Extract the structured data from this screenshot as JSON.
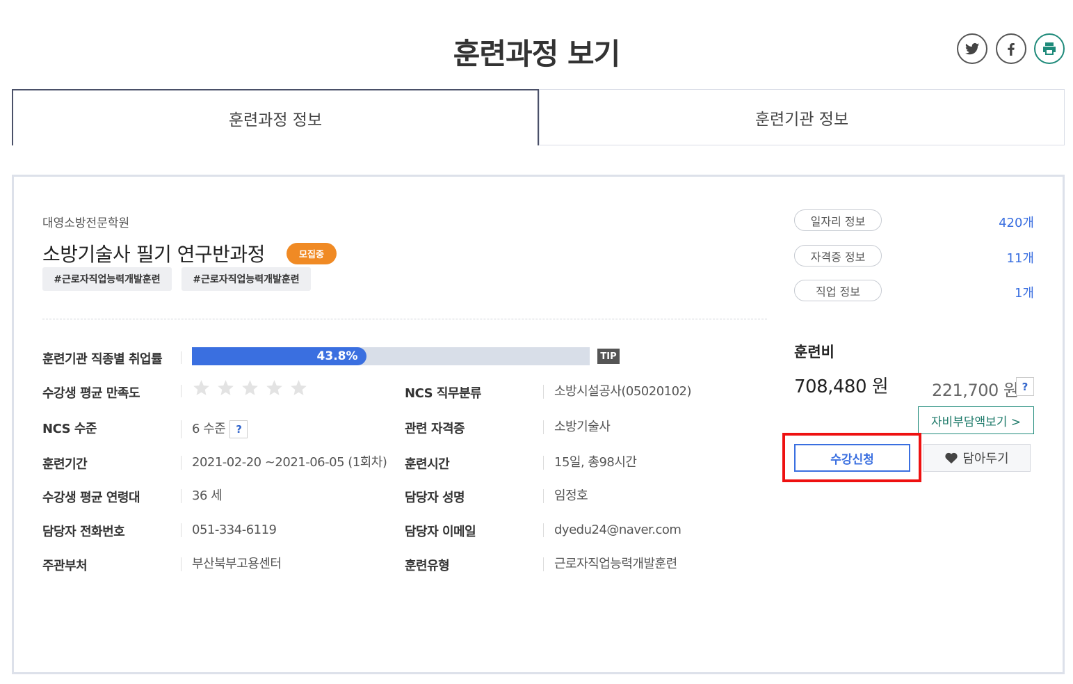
{
  "page_title": "훈련과정 보기",
  "share": {
    "twitter_icon": "twitter-icon",
    "facebook_icon": "facebook-icon",
    "print_icon": "print-icon"
  },
  "tabs": [
    {
      "label": "훈련과정 정보",
      "active": true
    },
    {
      "label": "훈련기관 정보",
      "active": false
    }
  ],
  "course": {
    "institution": "대영소방전문학원",
    "title": "소방기술사 필기 연구반과정",
    "badge": "모집중",
    "tags": [
      "#근로자직업능력개발훈련",
      "#근로자직업능력개발훈련"
    ]
  },
  "stats": {
    "employment_label": "훈련기관 직종별 취업률",
    "employment_rate": "43.8%",
    "employment_fraction": 0.438,
    "tip_label": "TIP",
    "satisfaction_label": "수강생 평균 만족도",
    "satisfaction_stars": 0,
    "satisfaction_max": 5
  },
  "info_left": [
    {
      "label": "NCS 수준",
      "value": "6 수준",
      "help": "?"
    },
    {
      "label": "훈련기간",
      "value": "2021-02-20 ~2021-06-05 (1회차)"
    },
    {
      "label": "수강생 평균 연령대",
      "value": "36 세"
    },
    {
      "label": "담당자 전화번호",
      "value": "051-334-6119"
    },
    {
      "label": "주관부처",
      "value": "부산북부고용센터"
    }
  ],
  "info_right": [
    {
      "label": "NCS 직무분류",
      "value": "소방시설공사(05020102)"
    },
    {
      "label": "관련 자격증",
      "value": "소방기술사"
    },
    {
      "label": "훈련시간",
      "value": "15일, 총98시간"
    },
    {
      "label": "담당자 성명",
      "value": "임정호"
    },
    {
      "label": "담당자 이메일",
      "value": "dyedu24@naver.com"
    },
    {
      "label": "훈련유형",
      "value": "근로자직업능력개발훈련"
    }
  ],
  "side": {
    "pills": [
      {
        "label": "일자리 정보",
        "count": "420개"
      },
      {
        "label": "자격증 정보",
        "count": "11개"
      },
      {
        "label": "직업 정보",
        "count": "1개"
      }
    ],
    "fee_label": "훈련비",
    "fee_total": "708,480 원",
    "fee_self": "221,700 원",
    "fee_help": "?",
    "self_pay_button": "자비부담액보기 >",
    "apply_button": "수강신청",
    "save_button": "담아두기"
  },
  "colors": {
    "accent": "#3a6fe0",
    "badge": "#f08a24",
    "highlight": "#ee1111",
    "teal": "#1e8a7a"
  }
}
